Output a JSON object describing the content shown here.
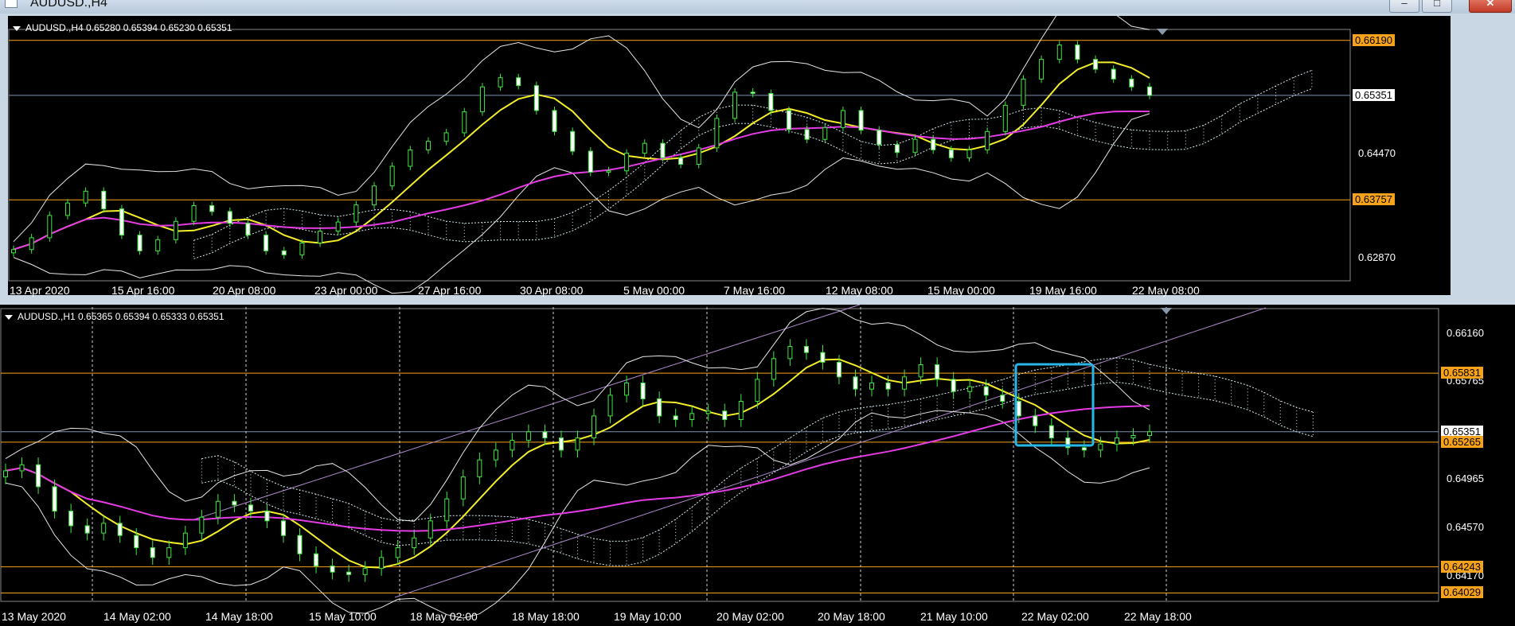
{
  "window": {
    "title": "AUDUSD.,H4"
  },
  "chart_data": [
    {
      "type": "candlestick",
      "symbol_header": "AUDUSD.,H4  0.65280 0.65394 0.65230 0.65351",
      "y_ticks": [
        "0.66190",
        "0.65351",
        "0.64470",
        "0.63757",
        "0.62870"
      ],
      "y_tick_values": [
        0.6619,
        0.65351,
        0.6447,
        0.63757,
        0.6287
      ],
      "ylim": [
        0.6256,
        0.6632
      ],
      "x_ticks": [
        "13 Apr 2020",
        "15 Apr 16:00",
        "20 Apr 08:00",
        "23 Apr 00:00",
        "27 Apr 16:00",
        "30 Apr 08:00",
        "5 May 00:00",
        "7 May 16:00",
        "12 May 08:00",
        "15 May 00:00",
        "19 May 16:00",
        "22 May 08:00"
      ],
      "horizontal_levels": [
        {
          "value": 0.6619,
          "label": "0.66190",
          "color": "#f7a21b"
        },
        {
          "value": 0.63757,
          "label": "0.63757",
          "color": "#f7a21b"
        },
        {
          "value": 0.65351,
          "label": "0.65351",
          "color": "#ffffff"
        }
      ],
      "close_series": [
        0.63,
        0.6318,
        0.6352,
        0.6371,
        0.6389,
        0.6362,
        0.6322,
        0.6298,
        0.6315,
        0.6343,
        0.6367,
        0.6358,
        0.634,
        0.6322,
        0.6298,
        0.6292,
        0.631,
        0.6328,
        0.6342,
        0.6368,
        0.6397,
        0.6427,
        0.6452,
        0.6465,
        0.6478,
        0.651,
        0.6548,
        0.6562,
        0.655,
        0.6512,
        0.648,
        0.645,
        0.6418,
        0.642,
        0.6447,
        0.6462,
        0.644,
        0.643,
        0.6455,
        0.65,
        0.654,
        0.6538,
        0.6512,
        0.6483,
        0.6468,
        0.6486,
        0.6512,
        0.6482,
        0.646,
        0.6448,
        0.6468,
        0.6452,
        0.644,
        0.6452,
        0.648,
        0.652,
        0.656,
        0.659,
        0.6612,
        0.659,
        0.6575,
        0.656,
        0.6548,
        0.6535
      ]
    },
    {
      "type": "candlestick",
      "symbol_header": "AUDUSD.,H1  0.65365 0.65394 0.65333 0.65351",
      "y_ticks": [
        "0.66160",
        "0.65765",
        "0.65351",
        "0.64965",
        "0.64570",
        "0.64170"
      ],
      "y_tick_values": [
        0.6616,
        0.65765,
        0.65351,
        0.64965,
        0.6457,
        0.6417
      ],
      "ylim": [
        0.6398,
        0.6634
      ],
      "x_ticks": [
        "13 May 2020",
        "14 May 02:00",
        "14 May 18:00",
        "15 May 10:00",
        "18 May 02:00",
        "18 May 18:00",
        "19 May 10:00",
        "20 May 02:00",
        "20 May 18:00",
        "21 May 10:00",
        "22 May 02:00",
        "22 May 18:00"
      ],
      "horizontal_levels": [
        {
          "value": 0.65831,
          "label": "0.65831",
          "color": "#f7a21b"
        },
        {
          "value": 0.65265,
          "label": "0.65265",
          "color": "#f7a21b"
        },
        {
          "value": 0.64243,
          "label": "0.64243",
          "color": "#f7a21b"
        },
        {
          "value": 0.64029,
          "label": "0.64029",
          "color": "#f7a21b"
        },
        {
          "value": 0.65351,
          "label": "0.65351",
          "color": "#ffffff"
        }
      ],
      "close_series": [
        0.6503,
        0.6508,
        0.649,
        0.647,
        0.6458,
        0.6452,
        0.646,
        0.645,
        0.644,
        0.6432,
        0.644,
        0.6452,
        0.6465,
        0.6478,
        0.6475,
        0.647,
        0.6462,
        0.645,
        0.6435,
        0.6425,
        0.642,
        0.6418,
        0.6423,
        0.6432,
        0.644,
        0.6448,
        0.6462,
        0.648,
        0.6498,
        0.6512,
        0.652,
        0.6528,
        0.6535,
        0.653,
        0.652,
        0.653,
        0.6548,
        0.6565,
        0.6575,
        0.6562,
        0.6548,
        0.6545,
        0.655,
        0.6552,
        0.6545,
        0.656,
        0.6578,
        0.6595,
        0.6605,
        0.66,
        0.6592,
        0.658,
        0.657,
        0.6575,
        0.657,
        0.658,
        0.659,
        0.6578,
        0.6568,
        0.6572,
        0.6565,
        0.656,
        0.6548,
        0.654,
        0.653,
        0.6522,
        0.652,
        0.6525,
        0.653,
        0.6532,
        0.6535
      ],
      "highlight_box": {
        "color": "#29b6e8"
      }
    }
  ]
}
